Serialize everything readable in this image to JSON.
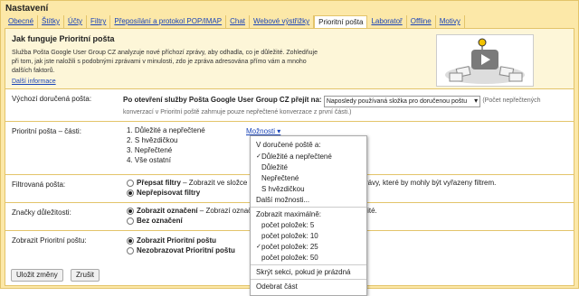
{
  "title": "Nastavení",
  "tabs": [
    "Obecné",
    "Štítky",
    "Účty",
    "Filtry",
    "Přeposílání a protokol POP/IMAP",
    "Chat",
    "Webové výstřižky",
    "Prioritní pošta",
    "Laboratoř",
    "Offline",
    "Motivy"
  ],
  "active_tab": "Prioritní pošta",
  "intro": {
    "heading": "Jak funguje Prioritní pošta",
    "text": "Služba Pošta Google User Group CZ analyzuje nové příchozí zprávy, aby odhadla, co je důležité. Zohledňuje při tom, jak jste naložili s podobnými zprávami v minulosti, zdo je zpráva adresována přímo vám a mnoho dalších faktorů.",
    "more_link": "Další informace"
  },
  "rows": {
    "default_inbox": {
      "label": "Výchozí doručená pošta:",
      "text_bold": "Po otevření služby Pošta Google User Group CZ přejít na:",
      "select_value": "Naposledy používaná složka pro doručenou poštu",
      "note": "(Počet nepřečtených konverzací v Prioritní poště zahrnuje pouze nepřečtené konverzace z první části.)"
    },
    "sections": {
      "label": "Prioritní pošta – části:",
      "items": [
        "1. Důležité a nepřečtené",
        "2. S hvězdičkou",
        "3. Nepřečtené",
        "4. Vše ostatní"
      ],
      "options_link": "Možnosti"
    },
    "filtered": {
      "label": "Filtrovaná pošta:",
      "option1": "Přepsat filtry",
      "option1_rest": " – Zobrazit ve složce Doručená pošta všechny důležité zprávy, které by mohly být vyřazeny filtrem.",
      "option2": "Nepřepisovat filtry"
    },
    "markers": {
      "label": "Značky důležitosti:",
      "option1": "Zobrazit označení",
      "option1_rest": " – Zobrazí označení u zpráv, které jsou pro vás důležité.",
      "option2": "Bez označení"
    },
    "show": {
      "label": "Zobrazit Prioritní poštu:",
      "option1": "Zobrazit Prioritní poštu",
      "option2": "Nezobrazovat Prioritní poštu"
    }
  },
  "buttons": {
    "save": "Uložit změny",
    "cancel": "Zrušit"
  },
  "menu": {
    "header": "V doručené poště a:",
    "items": [
      "Důležité a nepřečtené",
      "Důležité",
      "Nepřečtené",
      "S hvězdičkou"
    ],
    "more": "Další možnosti...",
    "max_label": "Zobrazit maximálně:",
    "counts": [
      "počet položek: 5",
      "počet položek: 10",
      "počet položek: 25",
      "počet položek: 50"
    ],
    "hide": "Skrýt sekci, pokud je prázdná",
    "remove": "Odebrat část"
  }
}
